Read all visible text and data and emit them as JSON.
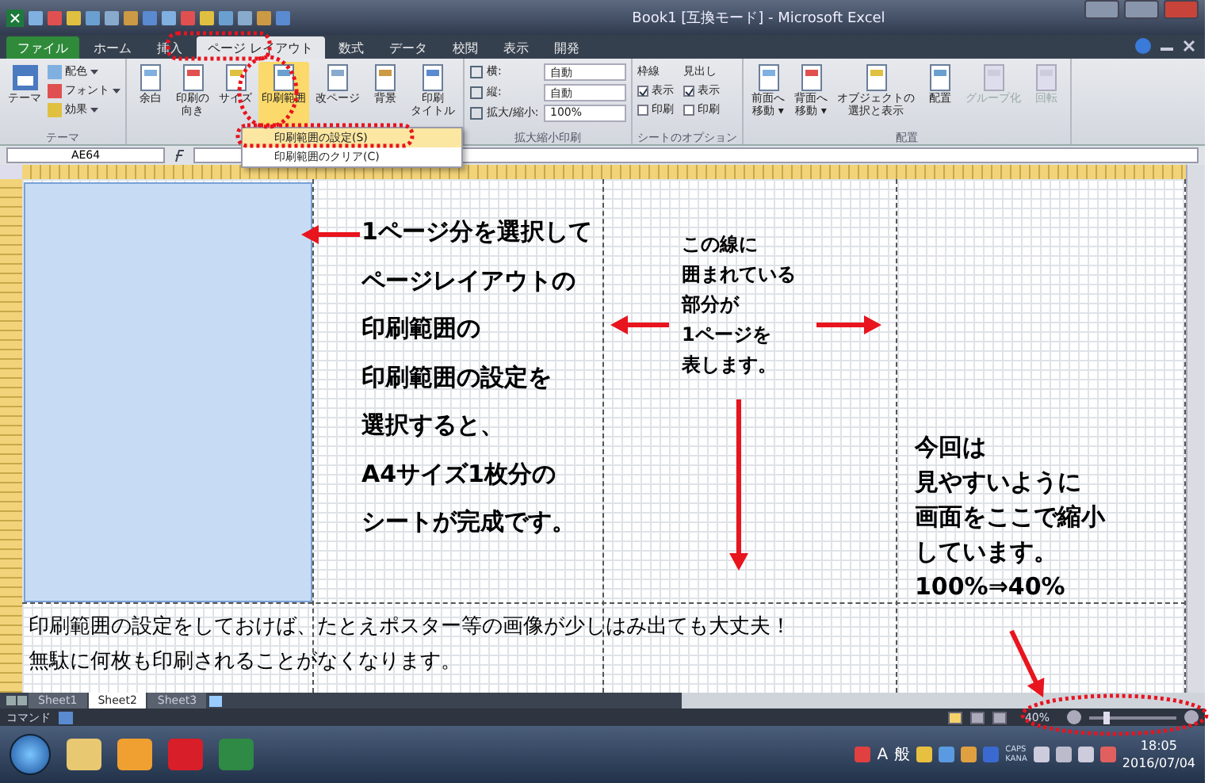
{
  "window": {
    "title": "Book1 [互換モード] - Microsoft Excel"
  },
  "ribbon_tabs": [
    {
      "label": "ファイル",
      "kind": "file",
      "selected": false
    },
    {
      "label": "ホーム",
      "kind": "tab",
      "selected": false
    },
    {
      "label": "挿入",
      "kind": "tab",
      "selected": false
    },
    {
      "label": "ページ レイアウト",
      "kind": "tab",
      "selected": true
    },
    {
      "label": "数式",
      "kind": "tab",
      "selected": false
    },
    {
      "label": "データ",
      "kind": "tab",
      "selected": false
    },
    {
      "label": "校閲",
      "kind": "tab",
      "selected": false
    },
    {
      "label": "表示",
      "kind": "tab",
      "selected": false
    },
    {
      "label": "開発",
      "kind": "tab",
      "selected": false
    }
  ],
  "ribbon_groups": [
    {
      "kind": "theme",
      "label": "テーマ",
      "large": "テーマ",
      "small": [
        {
          "label": "配色"
        },
        {
          "label": "フォント"
        },
        {
          "label": "効果"
        }
      ]
    },
    {
      "kind": "buttons",
      "buttons": [
        {
          "label": "余白",
          "pressed": false,
          "disabled": false
        },
        {
          "label": [
            "印刷の",
            "向き"
          ],
          "pressed": false,
          "disabled": false
        },
        {
          "label": "サイズ",
          "pressed": false,
          "disabled": false
        },
        {
          "label": "印刷範囲",
          "pressed": true,
          "disabled": false
        },
        {
          "label": "改ページ",
          "pressed": false,
          "disabled": false
        },
        {
          "label": "背景",
          "pressed": false,
          "disabled": false
        },
        {
          "label": [
            "印刷",
            "タイトル"
          ],
          "pressed": false,
          "disabled": false
        }
      ]
    },
    {
      "kind": "scale",
      "label": "拡大縮小印刷",
      "fields": [
        {
          "label": "横:",
          "value": "自動"
        },
        {
          "label": "縦:",
          "value": "自動"
        },
        {
          "label": "拡大/縮小:",
          "value": "100%"
        }
      ]
    },
    {
      "kind": "options",
      "label": "シートのオプション",
      "columns": [
        {
          "title": "枠線",
          "options": [
            {
              "label": "表示",
              "checked": true
            },
            {
              "label": "印刷",
              "checked": false
            }
          ]
        },
        {
          "title": "見出し",
          "options": [
            {
              "label": "表示",
              "checked": true
            },
            {
              "label": "印刷",
              "checked": false
            }
          ]
        }
      ]
    },
    {
      "kind": "buttons",
      "label": "配置",
      "buttons": [
        {
          "label": [
            "前面へ",
            "移動 ▾"
          ],
          "pressed": false,
          "disabled": false
        },
        {
          "label": [
            "背面へ",
            "移動 ▾"
          ],
          "pressed": false,
          "disabled": false
        },
        {
          "label": [
            "オブジェクトの",
            "選択と表示"
          ],
          "pressed": false,
          "disabled": false
        },
        {
          "label": "配置",
          "pressed": false,
          "disabled": false
        },
        {
          "label": "グループ化",
          "pressed": false,
          "disabled": true
        },
        {
          "label": "回転",
          "pressed": false,
          "disabled": true
        }
      ]
    }
  ],
  "dropdown_menu": [
    {
      "label": "印刷範囲の設定(S)",
      "selected": true
    },
    {
      "label": "印刷範囲のクリア(C)",
      "selected": false
    }
  ],
  "formula_bar": {
    "name_box": "AE64"
  },
  "annotations": [
    {
      "lines": [
        "1ページ分を選択して",
        "ページレイアウトの",
        "印刷範囲の",
        "印刷範囲の設定を",
        "選択すると、",
        "A4サイズ1枚分の",
        "シートが完成です。"
      ]
    },
    {
      "lines": [
        "この線に",
        "囲まれている",
        "部分が",
        "1ページを",
        "表します。"
      ]
    },
    {
      "lines": [
        "今回は",
        "見やすいように",
        "画面をここで縮小",
        "しています。",
        "100%⇒40%"
      ]
    },
    {
      "lines": [
        "印刷範囲の設定をしておけば、たとえポスター等の画像が少しはみ出ても大丈夫！",
        "無駄に何枚も印刷されることがなくなります。"
      ]
    }
  ],
  "sheet_tabs": [
    {
      "label": "Sheet1",
      "selected": false
    },
    {
      "label": "Sheet2",
      "selected": true
    },
    {
      "label": "Sheet3",
      "selected": false
    }
  ],
  "status_bar": {
    "mode": "コマンド",
    "views": [
      {
        "selected": true
      },
      {
        "selected": false
      },
      {
        "selected": false
      }
    ],
    "zoom": "40%",
    "level": 0.2
  },
  "taskbar": {
    "ime": [
      "A",
      "般"
    ],
    "keys": [
      "CAPS",
      "KANA"
    ],
    "time": "18:05",
    "date": "2016/07/04"
  }
}
